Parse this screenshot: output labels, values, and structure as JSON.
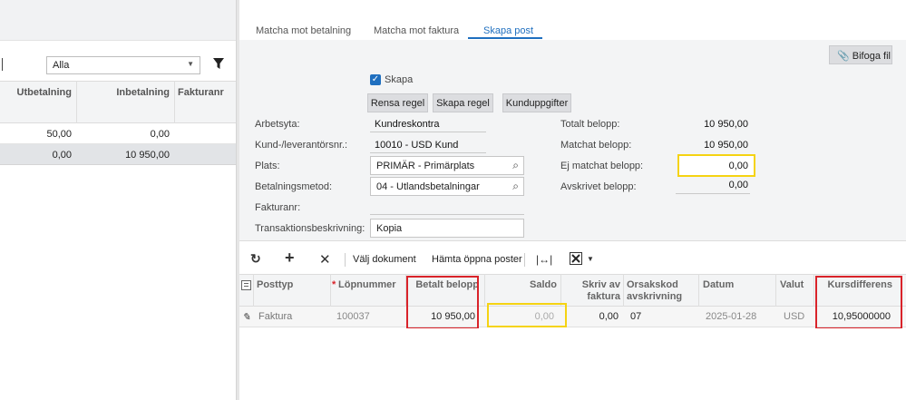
{
  "left": {
    "filter_value": "Alla",
    "columns": [
      "Utbetalning",
      "Inbetalning",
      "Fakturanr"
    ],
    "rows": [
      {
        "utbetalning": "50,00",
        "inbetalning": "0,00"
      },
      {
        "utbetalning": "0,00",
        "inbetalning": "10 950,00"
      }
    ]
  },
  "tabs": [
    "Matcha mot betalning",
    "Matcha mot faktura",
    "Skapa post"
  ],
  "attach_label": "Bifoga fil",
  "checkbox_label": "Skapa",
  "buttons": [
    "Rensa regel",
    "Skapa regel",
    "Kunduppgifter"
  ],
  "form": {
    "arbetsyta_label": "Arbetsyta:",
    "arbetsyta_value": "Kundreskontra",
    "kund_label": "Kund-/leverantörsnr.:",
    "kund_value": "10010 - USD Kund",
    "plats_label": "Plats:",
    "plats_value": "PRIMÄR - Primärplats",
    "betmetod_label": "Betalningsmetod:",
    "betmetod_value": "04 - Utlandsbetalningar",
    "fakturanr_label": "Fakturanr:",
    "trans_label": "Transaktionsbeskrivning:",
    "trans_value": "Kopia"
  },
  "totals": {
    "totalt_label": "Totalt belopp:",
    "totalt_value": "10 950,00",
    "matchat_label": "Matchat belopp:",
    "matchat_value": "10 950,00",
    "ej_matchat_label": "Ej matchat belopp:",
    "ej_matchat_value": "0,00",
    "avskrivet_label": "Avskrivet belopp:",
    "avskrivet_value": "0,00"
  },
  "toolbar": {
    "valj_dokument": "Välj dokument",
    "hamta_poster": "Hämta öppna poster"
  },
  "grid": {
    "headers": {
      "posttyp": "Posttyp",
      "required_mark": "*",
      "lopnummer": "Löpnummer",
      "betalt": "Betalt belopp",
      "saldo": "Saldo",
      "skriv_av_1": "Skriv av",
      "skriv_av_2": "faktura",
      "orsak_1": "Orsakskod",
      "orsak_2": "avskrivning",
      "datum": "Datum",
      "valut": "Valut",
      "kursdiff": "Kursdifferens"
    },
    "row": {
      "posttyp": "Faktura",
      "lopnummer": "100037",
      "betalt": "10 950,00",
      "saldo": "0,00",
      "skriv_av": "0,00",
      "orsak": "07",
      "datum": "2025-01-28",
      "valut": "USD",
      "kursdiff": "10,95000000"
    }
  },
  "colors": {
    "accent": "#1f6fbf",
    "highlight_yellow": "#f5d312",
    "highlight_red": "#d9232a"
  }
}
